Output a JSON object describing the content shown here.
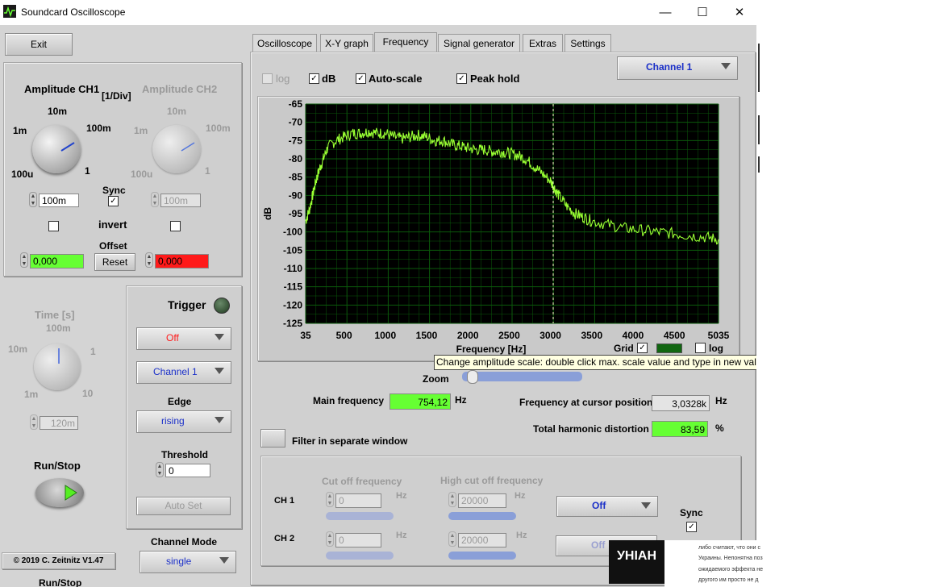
{
  "window": {
    "title": "Soundcard Oscilloscope",
    "minimize": "—",
    "maximize": "☐",
    "close": "✕"
  },
  "left": {
    "exit_label": "Exit",
    "amp_ch1": {
      "title": "Amplitude CH1",
      "unit": "[1/Div]",
      "tick_10m": "10m",
      "tick_1m": "1m",
      "tick_100m": "100m",
      "tick_100u": "100u",
      "tick_1": "1",
      "value": "100m"
    },
    "amp_ch2": {
      "title": "Amplitude CH2",
      "tick_10m": "10m",
      "tick_1m": "1m",
      "tick_100m": "100m",
      "tick_100u": "100u",
      "tick_1": "1",
      "value": "100m"
    },
    "sync_label": "Sync",
    "invert_label": "invert",
    "offset_label": "Offset",
    "offset_ch1": "0,000",
    "offset_ch2": "0,000",
    "reset_label": "Reset",
    "time": {
      "title": "Time [s]",
      "tick_100m": "100m",
      "tick_10m": "10m",
      "tick_1": "1",
      "tick_1m": "1m",
      "tick_10": "10",
      "value": "120m"
    },
    "run_stop_label": "Run/Stop",
    "copyright": "© 2019  C. Zeitnitz V1.47",
    "cut_text": "Run/Stop"
  },
  "trigger": {
    "title": "Trigger",
    "mode": "Off",
    "channel": "Channel 1",
    "edge_label": "Edge",
    "edge": "rising",
    "threshold_label": "Threshold",
    "threshold": "0",
    "autoset_label": "Auto Set"
  },
  "channel_mode": {
    "label": "Channel Mode",
    "value": "single"
  },
  "tabs": [
    "Oscilloscope",
    "X-Y graph",
    "Frequency",
    "Signal generator",
    "Extras",
    "Settings"
  ],
  "freq": {
    "log_label": "log",
    "db_label": "dB",
    "autoscale_label": "Auto-scale",
    "peakhold_label": "Peak hold",
    "channel": "Channel 1",
    "grid_label": "Grid",
    "log2_label": "log",
    "tooltip": "Change amplitude scale: double click max. scale value and type in new value",
    "zoom_label": "Zoom",
    "main_freq_label": "Main frequency",
    "main_freq": "754,12",
    "hz1": "Hz",
    "cursor_freq_label": "Frequency at cursor position",
    "cursor_freq": "3,0328k",
    "hz2": "Hz",
    "thd_label": "Total harmonic distortion",
    "thd": "83,59",
    "pct": "%",
    "filter_label": "Filter in separate window"
  },
  "filter": {
    "cutoff_label": "Cut off frequency",
    "highcut_label": "High cut off frequency",
    "ch1_label": "CH 1",
    "ch2_label": "CH 2",
    "hz": "Hz",
    "ch1_low": "0",
    "ch1_high": "20000",
    "ch2_low": "0",
    "ch2_high": "20000",
    "ch1_mode": "Off",
    "ch2_mode": "Off",
    "sync_label": "Sync"
  },
  "chart_data": {
    "type": "line",
    "xlabel": "Frequency [Hz]",
    "ylabel": "dB",
    "xlim": [
      35,
      5035
    ],
    "ylim": [
      -125,
      -65
    ],
    "x_ticks": [
      35,
      500,
      1000,
      1500,
      2000,
      2500,
      3000,
      3500,
      4000,
      4500,
      5035
    ],
    "y_ticks": [
      -65,
      -70,
      -75,
      -80,
      -85,
      -90,
      -95,
      -100,
      -105,
      -110,
      -115,
      -120,
      -125
    ],
    "grid": true,
    "cursor_x": 3033,
    "series": [
      {
        "color": "#99ff33",
        "x": [
          35,
          80,
          120,
          160,
          200,
          250,
          300,
          400,
          500,
          600,
          700,
          800,
          900,
          1000,
          1100,
          1200,
          1300,
          1400,
          1500,
          1600,
          1700,
          1800,
          1900,
          2000,
          2100,
          2200,
          2300,
          2400,
          2500,
          2600,
          2700,
          2800,
          2900,
          3000,
          3050,
          3100,
          3200,
          3300,
          3400,
          3500,
          3700,
          3900,
          4100,
          4300,
          4500,
          4700,
          4900,
          5035
        ],
        "values": [
          -97,
          -94,
          -90,
          -86,
          -83,
          -80,
          -77,
          -75,
          -74,
          -73,
          -73,
          -72.5,
          -73,
          -73,
          -74,
          -74.5,
          -74,
          -73.5,
          -74,
          -75,
          -75,
          -76,
          -76.5,
          -77,
          -77.5,
          -77.5,
          -78,
          -78,
          -78.5,
          -79,
          -80,
          -82,
          -84,
          -86,
          -88,
          -90,
          -93,
          -95,
          -96,
          -97,
          -98,
          -99,
          -99.5,
          -100,
          -100.5,
          -101,
          -101.5,
          -102
        ]
      }
    ]
  },
  "overlay": {
    "logo": "УНІАН",
    "line1": "либо считают, что они с",
    "line2": "Украины. Непонятна поз",
    "line3": "ожидаемого эффекта не",
    "line4": "другого им просто не д"
  }
}
